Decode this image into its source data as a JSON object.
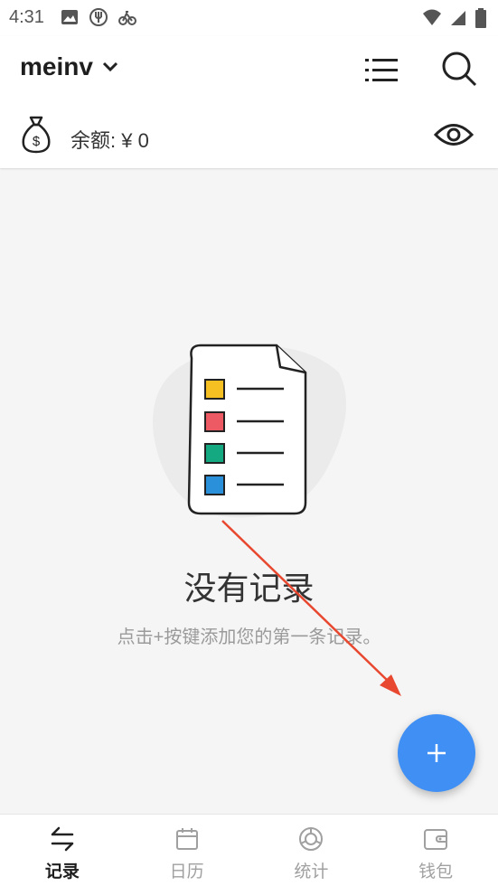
{
  "status_bar": {
    "time": "4:31",
    "left_icons": [
      "image-icon",
      "fork-knife-icon",
      "bike-icon"
    ],
    "right_icons": [
      "wifi-icon",
      "signal-icon",
      "battery-icon"
    ]
  },
  "header": {
    "account_name": "meinv",
    "balance_label": "余额: ¥ 0"
  },
  "empty_state": {
    "title": "没有记录",
    "hint": "点击+按键添加您的第一条记录。"
  },
  "nav": {
    "items": [
      {
        "label": "记录",
        "icon": "transfer-icon",
        "active": true
      },
      {
        "label": "日历",
        "icon": "calendar-icon",
        "active": false
      },
      {
        "label": "统计",
        "icon": "chart-ring-icon",
        "active": false
      },
      {
        "label": "钱包",
        "icon": "wallet-icon",
        "active": false
      }
    ]
  },
  "colors": {
    "accent": "#3f8ff5",
    "arrow": "#e8482f",
    "list_yellow": "#f6c022",
    "list_red": "#ee5a64",
    "list_green": "#14a980",
    "list_blue": "#2990d9"
  }
}
